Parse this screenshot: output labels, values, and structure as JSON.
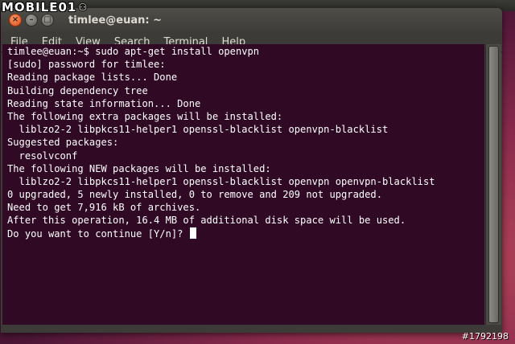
{
  "watermark": {
    "brand": "MOBILE01",
    "icon": "mobile01-logo-icon"
  },
  "window": {
    "title": "timlee@euan: ~",
    "close_icon": "×",
    "min_icon": "–",
    "max_icon": "□"
  },
  "menu": [
    "File",
    "Edit",
    "View",
    "Search",
    "Terminal",
    "Help"
  ],
  "terminal": {
    "lines": [
      "timlee@euan:~$ sudo apt-get install openvpn",
      "[sudo] password for timlee:",
      "Reading package lists... Done",
      "Building dependency tree",
      "Reading state information... Done",
      "The following extra packages will be installed:",
      "  liblzo2-2 libpkcs11-helper1 openssl-blacklist openvpn-blacklist",
      "Suggested packages:",
      "  resolvconf",
      "The following NEW packages will be installed:",
      "  liblzo2-2 libpkcs11-helper1 openssl-blacklist openvpn openvpn-blacklist",
      "0 upgraded, 5 newly installed, 0 to remove and 209 not upgraded.",
      "Need to get 7,916 kB of archives.",
      "After this operation, 16.4 MB of additional disk space will be used."
    ],
    "prompt_line": "Do you want to continue [Y/n]? "
  },
  "image_id": "#1792198",
  "colors": {
    "terminal_bg": "#300a24",
    "terminal_fg": "#ffffff",
    "close_button": "#df4a16"
  }
}
